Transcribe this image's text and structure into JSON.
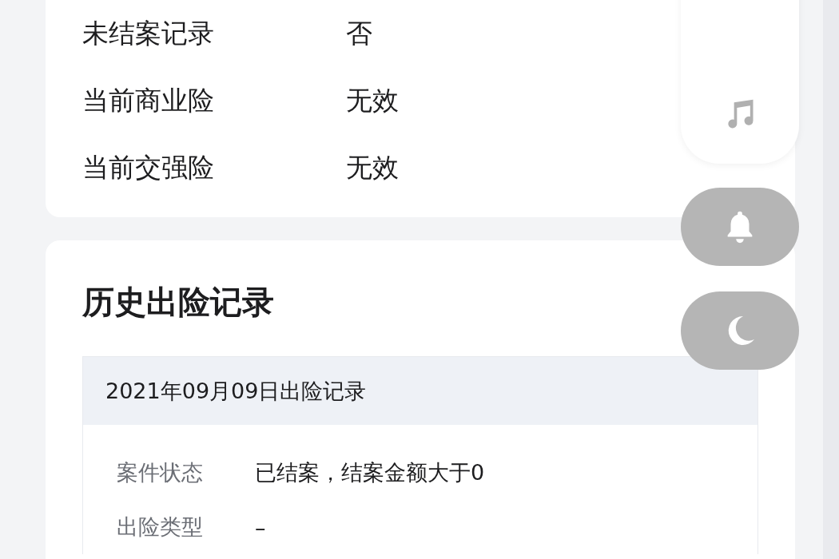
{
  "summary_card": {
    "rows": [
      {
        "label": "未结案记录",
        "value": "否"
      },
      {
        "label": "当前商业险",
        "value": "无效"
      },
      {
        "label": "当前交强险",
        "value": "无效"
      }
    ]
  },
  "history": {
    "title": "历史出险记录",
    "records": [
      {
        "header": "2021年09月09日出险记录",
        "fields": [
          {
            "label": "案件状态",
            "value": "已结案，结案金额大于0"
          },
          {
            "label": "出险类型",
            "value": "–"
          }
        ]
      }
    ]
  },
  "floating_controls": [
    {
      "kind": "music"
    },
    {
      "kind": "bell"
    },
    {
      "kind": "moon"
    }
  ]
}
